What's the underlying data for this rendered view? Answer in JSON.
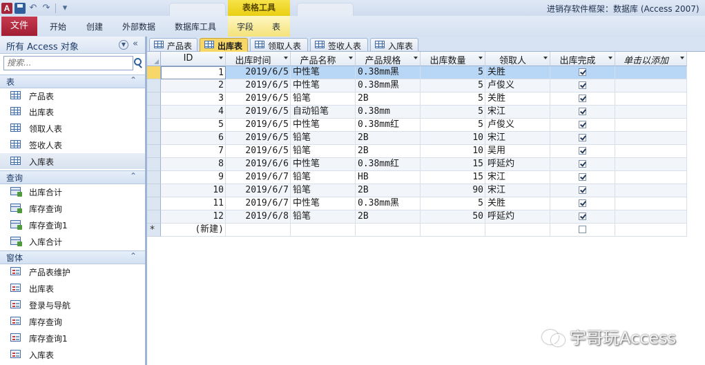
{
  "window": {
    "title": "进销存软件框架：数据库 (Access 2007)",
    "app_icon_letter": "A",
    "contextual_group": "表格工具"
  },
  "ribbon": {
    "tabs": [
      "文件",
      "开始",
      "创建",
      "外部数据",
      "数据库工具",
      "字段",
      "表"
    ]
  },
  "nav": {
    "title": "所有 Access 对象",
    "search_placeholder": "搜索...",
    "groups": [
      {
        "label": "表",
        "items": [
          "产品表",
          "出库表",
          "领取人表",
          "签收人表",
          "入库表"
        ],
        "icon": "table-icon"
      },
      {
        "label": "查询",
        "items": [
          "出库合计",
          "库存查询",
          "库存查询1",
          "入库合计"
        ],
        "icon": "query-icon"
      },
      {
        "label": "窗体",
        "items": [
          "产品表维护",
          "出库表",
          "登录与导航",
          "库存查询",
          "库存查询1",
          "入库表"
        ],
        "icon": "form-icon"
      }
    ],
    "selected": "入库表"
  },
  "doc_tabs": [
    "产品表",
    "出库表",
    "领取人表",
    "签收人表",
    "入库表"
  ],
  "active_doc_tab": "出库表",
  "datasheet": {
    "columns": [
      "ID",
      "出库时间",
      "产品名称",
      "产品规格",
      "出库数量",
      "领取人",
      "出库完成",
      "单击以添加"
    ],
    "rows": [
      [
        "1",
        "2019/6/5",
        "中性笔",
        "0.38mm黑",
        "5",
        "关胜",
        true
      ],
      [
        "2",
        "2019/6/5",
        "中性笔",
        "0.38mm黑",
        "5",
        "卢俊义",
        true
      ],
      [
        "3",
        "2019/6/5",
        "铅笔",
        "2B",
        "5",
        "关胜",
        true
      ],
      [
        "4",
        "2019/6/5",
        "自动铅笔",
        "0.38mm",
        "5",
        "宋江",
        true
      ],
      [
        "5",
        "2019/6/5",
        "中性笔",
        "0.38mm红",
        "5",
        "卢俊义",
        true
      ],
      [
        "6",
        "2019/6/5",
        "铅笔",
        "2B",
        "10",
        "宋江",
        true
      ],
      [
        "7",
        "2019/6/5",
        "铅笔",
        "2B",
        "10",
        "吴用",
        true
      ],
      [
        "8",
        "2019/6/6",
        "中性笔",
        "0.38mm红",
        "15",
        "呼延灼",
        true
      ],
      [
        "9",
        "2019/6/7",
        "铅笔",
        "HB",
        "15",
        "宋江",
        true
      ],
      [
        "10",
        "2019/6/7",
        "铅笔",
        "2B",
        "90",
        "宋江",
        true
      ],
      [
        "11",
        "2019/6/7",
        "中性笔",
        "0.38mm黑",
        "5",
        "关胜",
        true
      ],
      [
        "12",
        "2019/6/8",
        "铅笔",
        "2B",
        "50",
        "呼延灼",
        true
      ]
    ],
    "new_row_label": "(新建)",
    "new_row_marker": "*"
  },
  "watermark": "宇哥玩Access",
  "colors": {
    "file_tab": "#a11f34",
    "contextual": "#e9cf12",
    "selected_row": "#b8d6f5",
    "active_tab": "#f6d768"
  }
}
